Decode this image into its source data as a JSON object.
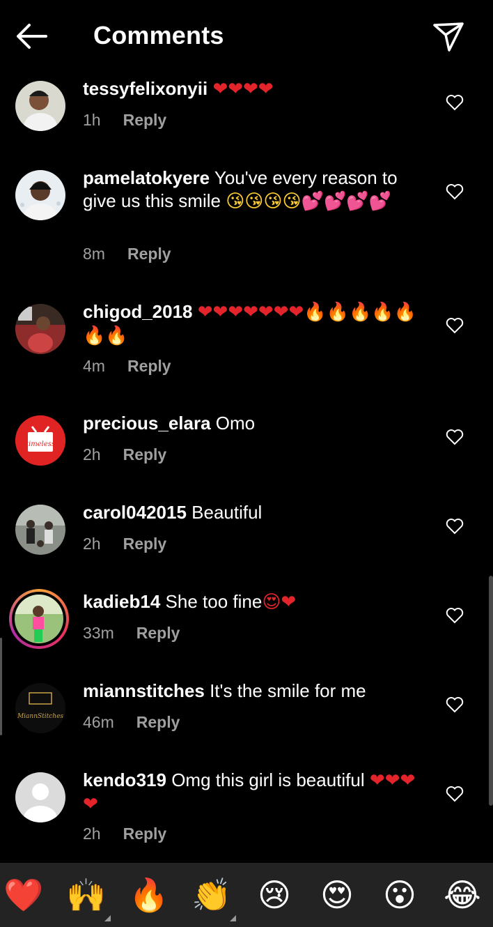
{
  "header": {
    "title": "Comments",
    "back_icon": "arrow-left-icon",
    "send_icon": "paper-plane-icon"
  },
  "comments": [
    {
      "username": "tessyfelixonyii",
      "text": "",
      "emojis": "❤❤❤❤",
      "time": "1h",
      "reply": "Reply"
    },
    {
      "username": "pamelatokyere",
      "text": "You've every reason to give us this smile",
      "emojis": "😘😘😘😘💕💕💕💕",
      "time": "8m",
      "reply": "Reply"
    },
    {
      "username": "chigod_2018",
      "text": "",
      "emojis": "❤❤❤❤❤❤❤🔥🔥🔥🔥🔥🔥🔥",
      "time": "4m",
      "reply": "Reply"
    },
    {
      "username": "precious_elara",
      "text": "Omo",
      "emojis": "",
      "time": "2h",
      "reply": "Reply"
    },
    {
      "username": "carol042015",
      "text": "Beautiful",
      "emojis": "",
      "time": "2h",
      "reply": "Reply"
    },
    {
      "username": "kadieb14",
      "text": "She too fine",
      "emojis": "😍❤",
      "time": "33m",
      "reply": "Reply"
    },
    {
      "username": "miannstitches",
      "text": "It's the smile for me",
      "emojis": "",
      "time": "46m",
      "reply": "Reply",
      "avatar_text": "MiannStitches"
    },
    {
      "username": "kendo319",
      "text": "Omg this girl is beautiful",
      "emojis": "❤❤❤❤",
      "time": "2h",
      "reply": "Reply"
    }
  ],
  "precious_avatar_label": "timeless",
  "emoji_bar": [
    "❤️",
    "🙌",
    "🔥",
    "👏",
    "😢",
    "😍",
    "😮",
    "😂"
  ],
  "colors": {
    "background": "#000000",
    "secondary_text": "#a0a0a0",
    "heart_red": "#e3242b",
    "emoji_bar_bg": "#232323",
    "precious_avatar_red": "#e02424"
  }
}
